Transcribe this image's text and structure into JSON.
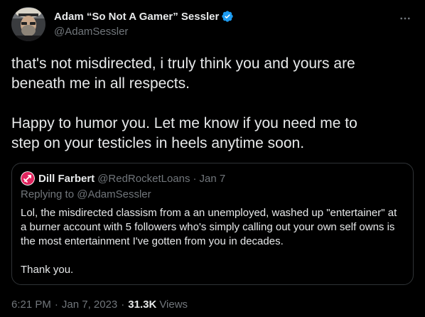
{
  "author": {
    "display_name": "Adam “So Not A Gamer” Sessler",
    "handle": "@AdamSessler"
  },
  "tweet": {
    "paragraph1_line1": "that's not misdirected, i truly think you and yours are",
    "paragraph1_line2": "beneath me in all respects.",
    "paragraph2_line1": "Happy to humor you. Let me know if you need me to",
    "paragraph2_line2": "step on your testicles in heels anytime soon."
  },
  "quoted": {
    "display_name": "Dill Farbert",
    "handle": "@RedRocketLoans",
    "separator": "·",
    "date": "Jan 7",
    "replying_to": "Replying to @AdamSessler",
    "line1": "Lol, the misdirected classism from a an unemployed, washed up \"entertainer\" at",
    "line2": "a burner account with 5 followers who's simply calling out your own self owns is",
    "line3": "the most entertainment I've gotten from you in decades.",
    "line4": "Thank you."
  },
  "meta": {
    "time": "6:21 PM",
    "separator": "·",
    "date": "Jan 7, 2023",
    "views_count": "31.3K",
    "views_label": "Views"
  },
  "icons": {
    "verified": "verified-badge-icon",
    "more": "more-horizontal-icon"
  },
  "colors": {
    "background": "#000000",
    "text_primary": "#e7e9ea",
    "text_secondary": "#71767b",
    "verified_blue": "#1d9bf0",
    "border": "#2f3336",
    "quoted_avatar": "#e0245e"
  }
}
